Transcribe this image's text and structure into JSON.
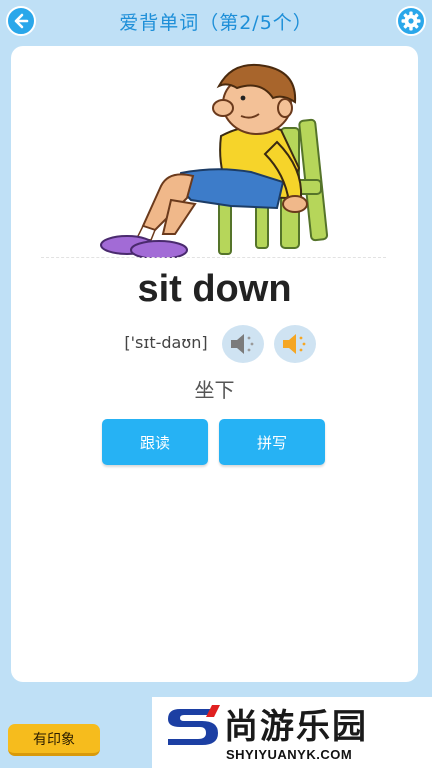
{
  "header": {
    "title": "爱背单词（第2/5个）",
    "back_icon": "arrow-left-icon",
    "settings_icon": "gear-icon"
  },
  "card": {
    "illustration": "boy-sitting-on-chair",
    "word": "sit down",
    "phonetic": "['sɪt-daʊn]",
    "meaning": "坐下",
    "speaker_icons": [
      "speaker-gray-icon",
      "speaker-orange-icon"
    ],
    "buttons": {
      "follow_read": "跟读",
      "spell": "拼写"
    }
  },
  "footer": {
    "impression_button": "有印象"
  },
  "watermark": {
    "name": "尚游乐园",
    "domain": "SHYIYUANYK.COM"
  },
  "colors": {
    "background": "#bfe0f6",
    "accent": "#26b2f4",
    "title": "#1e8fd8",
    "impression": "#f6bc1d"
  }
}
